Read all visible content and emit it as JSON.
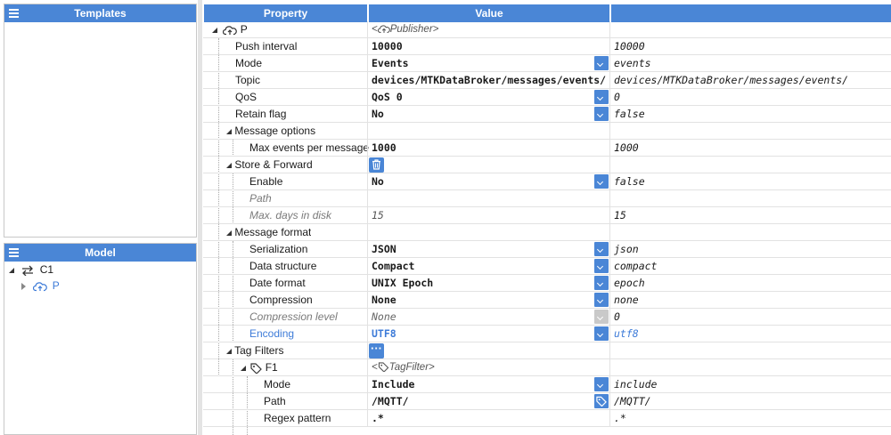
{
  "templates_panel": {
    "title": "Templates"
  },
  "model_panel": {
    "title": "Model",
    "tree": [
      {
        "label": "C1",
        "icon": "connection-arrows-icon"
      },
      {
        "label": "P",
        "icon": "cloud-upload-icon"
      }
    ]
  },
  "grid": {
    "headers": {
      "property": "Property",
      "value": "Value",
      "raw": ""
    },
    "root": {
      "name": "P",
      "value": "Publisher"
    },
    "rows": [
      {
        "name": "Push interval",
        "value": "10000",
        "raw": "10000"
      },
      {
        "name": "Mode",
        "value": "Events",
        "raw": "events"
      },
      {
        "name": "Topic",
        "value": "devices/MTKDataBroker/messages/events/",
        "raw": "devices/MTKDataBroker/messages/events/"
      },
      {
        "name": "QoS",
        "value": "QoS 0",
        "raw": "0"
      },
      {
        "name": "Retain flag",
        "value": "No",
        "raw": "false"
      },
      {
        "name": "Message options"
      },
      {
        "name": "Max events per message",
        "value": "1000",
        "raw": "1000"
      },
      {
        "name": "Store & Forward"
      },
      {
        "name": "Enable",
        "value": "No",
        "raw": "false"
      },
      {
        "name": "Path",
        "value": "",
        "raw": ""
      },
      {
        "name": "Max. days in disk",
        "value": "15",
        "raw": "15"
      },
      {
        "name": "Message format"
      },
      {
        "name": "Serialization",
        "value": "JSON",
        "raw": "json"
      },
      {
        "name": "Data structure",
        "value": "Compact",
        "raw": "compact"
      },
      {
        "name": "Date format",
        "value": "UNIX Epoch",
        "raw": "epoch"
      },
      {
        "name": "Compression",
        "value": "None",
        "raw": "none"
      },
      {
        "name": "Compression level",
        "value": "None",
        "raw": "0"
      },
      {
        "name": "Encoding",
        "value": "UTF8",
        "raw": "utf8"
      },
      {
        "name": "Tag Filters"
      },
      {
        "name": "F1",
        "value": "TagFilter"
      },
      {
        "name": "Mode",
        "value": "Include",
        "raw": "include"
      },
      {
        "name": "Path",
        "value": "/MQTT/",
        "raw": "/MQTT/"
      },
      {
        "name": "Regex pattern",
        "value": ".*",
        "raw": ".*"
      }
    ]
  },
  "colors": {
    "accent": "#4a86d6",
    "link_blue": "#3d7bd8"
  }
}
